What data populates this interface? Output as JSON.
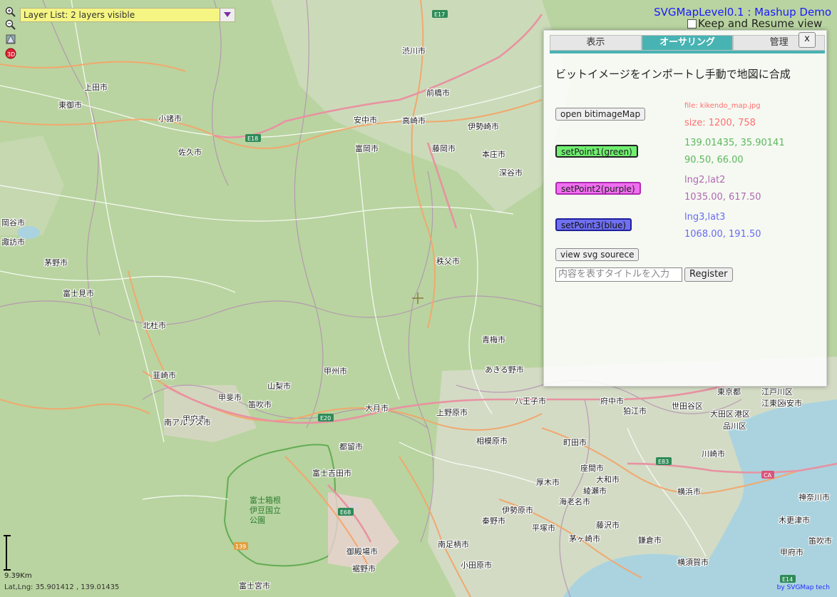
{
  "app": {
    "title": "SVGMapLevel0.1 : Mashup Demo",
    "keep_resume_label": "Keep and Resume view"
  },
  "layer_list": {
    "label": "Layer List: 2 layers visible"
  },
  "panel": {
    "close_label": "x",
    "tabs": [
      {
        "label": "表示",
        "active": false
      },
      {
        "label": "オーサリング",
        "active": true
      },
      {
        "label": "管理",
        "active": false
      }
    ],
    "heading": "ビットイメージをインポートし手動で地図に合成",
    "open_button": "open bitimageMap",
    "file_label": "file: kikendo_map.jpg",
    "size_label": "size: 1200, 758",
    "point1": {
      "button": "setPoint1(green)",
      "geo": "139.01435, 35.90141",
      "pix": "90.50, 66.00"
    },
    "point2": {
      "button": "setPoint2(purple)",
      "geo": "lng2,lat2",
      "pix": "1035.00, 617.50"
    },
    "point3": {
      "button": "setPoint3(blue)",
      "geo": "lng3,lat3",
      "pix": "1068.00, 191.50"
    },
    "view_source_button": "view svg sourece",
    "title_input_placeholder": "内容を表すタイトルを入力",
    "register_button": "Register"
  },
  "status": {
    "scale_label": "9.39Km",
    "latlng": "Lat,Lng: 35.901412 , 139.01435",
    "credit": "by SVGMap tech"
  },
  "map": {
    "places": [
      {
        "name": "上田市"
      },
      {
        "name": "東御市"
      },
      {
        "name": "小諸市"
      },
      {
        "name": "佐久市"
      },
      {
        "name": "安中市"
      },
      {
        "name": "高崎市"
      },
      {
        "name": "前橋市"
      },
      {
        "name": "伊勢崎市"
      },
      {
        "name": "富岡市"
      },
      {
        "name": "藤岡市"
      },
      {
        "name": "本庄市"
      },
      {
        "name": "深谷市"
      },
      {
        "name": "渋川市"
      },
      {
        "name": "諏訪市"
      },
      {
        "name": "茅野市"
      },
      {
        "name": "岡谷市"
      },
      {
        "name": "秩父市"
      },
      {
        "name": "青梅市"
      },
      {
        "name": "あきる野市"
      },
      {
        "name": "八王子市"
      },
      {
        "name": "北杜市"
      },
      {
        "name": "韮崎市"
      },
      {
        "name": "甲斐市"
      },
      {
        "name": "甲府市"
      },
      {
        "name": "甲州市"
      },
      {
        "name": "山梨市"
      },
      {
        "name": "笛吹市"
      },
      {
        "name": "南アルプス市"
      },
      {
        "name": "大月市"
      },
      {
        "name": "上野原市"
      },
      {
        "name": "都留市"
      },
      {
        "name": "富士吉田市"
      },
      {
        "name": "相模原市"
      },
      {
        "name": "町田市"
      },
      {
        "name": "厚木市"
      },
      {
        "name": "海老名市"
      },
      {
        "name": "伊勢原市"
      },
      {
        "name": "秦野市"
      },
      {
        "name": "平塚市"
      },
      {
        "name": "茅ヶ崎市"
      },
      {
        "name": "藤沢市"
      },
      {
        "name": "横浜市"
      },
      {
        "name": "鎌倉市"
      },
      {
        "name": "横須賀市"
      },
      {
        "name": "御殿場市"
      },
      {
        "name": "裾野市"
      },
      {
        "name": "小田原市"
      },
      {
        "name": "南足柄市"
      },
      {
        "name": "府中市"
      },
      {
        "name": "世田谷区"
      },
      {
        "name": "東京都"
      },
      {
        "name": "江戸川区"
      },
      {
        "name": "品川区"
      },
      {
        "name": "川崎市"
      },
      {
        "name": "座間市"
      },
      {
        "name": "大和市"
      },
      {
        "name": "綾瀬市"
      },
      {
        "name": "浦安市"
      },
      {
        "name": "木更津市"
      },
      {
        "name": "神奈川市"
      },
      {
        "name": "富士宮市"
      },
      {
        "name": "富士見市"
      },
      {
        "name": "甲府市"
      },
      {
        "name": "笛吹市"
      },
      {
        "name": "大田区"
      },
      {
        "name": "江東区"
      },
      {
        "name": "港区"
      },
      {
        "name": "狛江市"
      },
      {
        "name": "富士箱根伊豆国立公園"
      }
    ],
    "shields": [
      "E17",
      "E18",
      "E20",
      "E68",
      "E83",
      "E14",
      "CA",
      "139"
    ]
  }
}
